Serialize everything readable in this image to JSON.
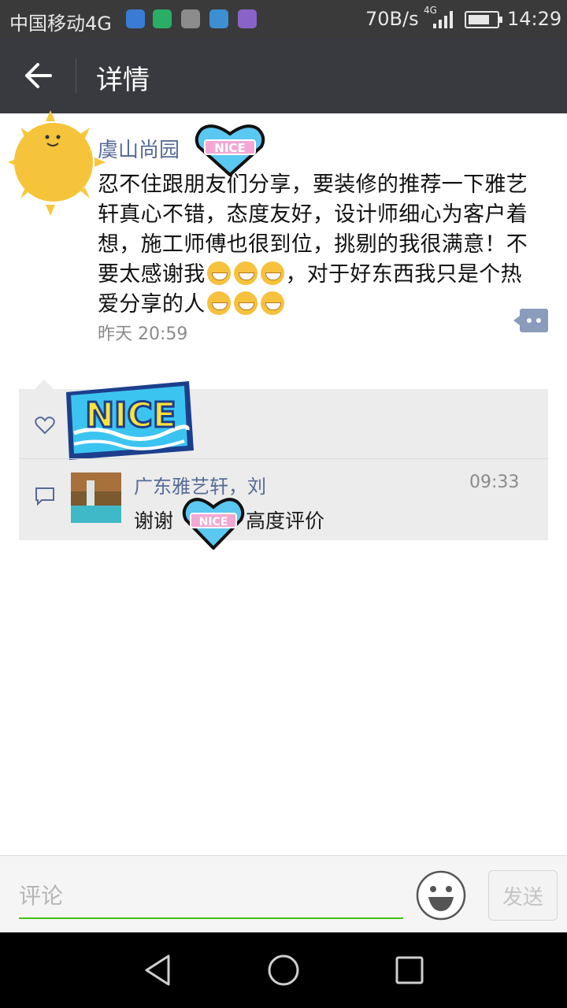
{
  "status_bar": {
    "carrier": "中国移动4G",
    "speed": "70B/s",
    "network": "4G",
    "time": "14:29"
  },
  "app_bar": {
    "back_icon": "arrow-left-icon",
    "title": "详情"
  },
  "post": {
    "author": "虞山尚园",
    "text_before_emoji": "忍不住跟朋友们分享，要装修的推荐一下雅艺轩真心不错，态度友好，设计师细心为客户着想，施工师傅也很到位，挑剔的我很满意！不要太感谢我",
    "text_middle": "，对于好东西我只是个热爱分享的人",
    "timestamp": "昨天 20:59",
    "more_icon": "comment-more-icon"
  },
  "interactions": {
    "like_icon": "heart-outline-icon",
    "comment_icon": "comment-bubble-icon",
    "comment": {
      "author": "广东雅艺轩，刘",
      "time": "09:33",
      "text_before": "谢谢",
      "text_after": "高度评价"
    }
  },
  "input_bar": {
    "placeholder": "评论",
    "send_label": "发送",
    "emoji_icon": "smiley-icon"
  },
  "colors": {
    "app_bar": "#393a3f",
    "link_blue": "#576b95",
    "input_underline": "#45c01a"
  }
}
